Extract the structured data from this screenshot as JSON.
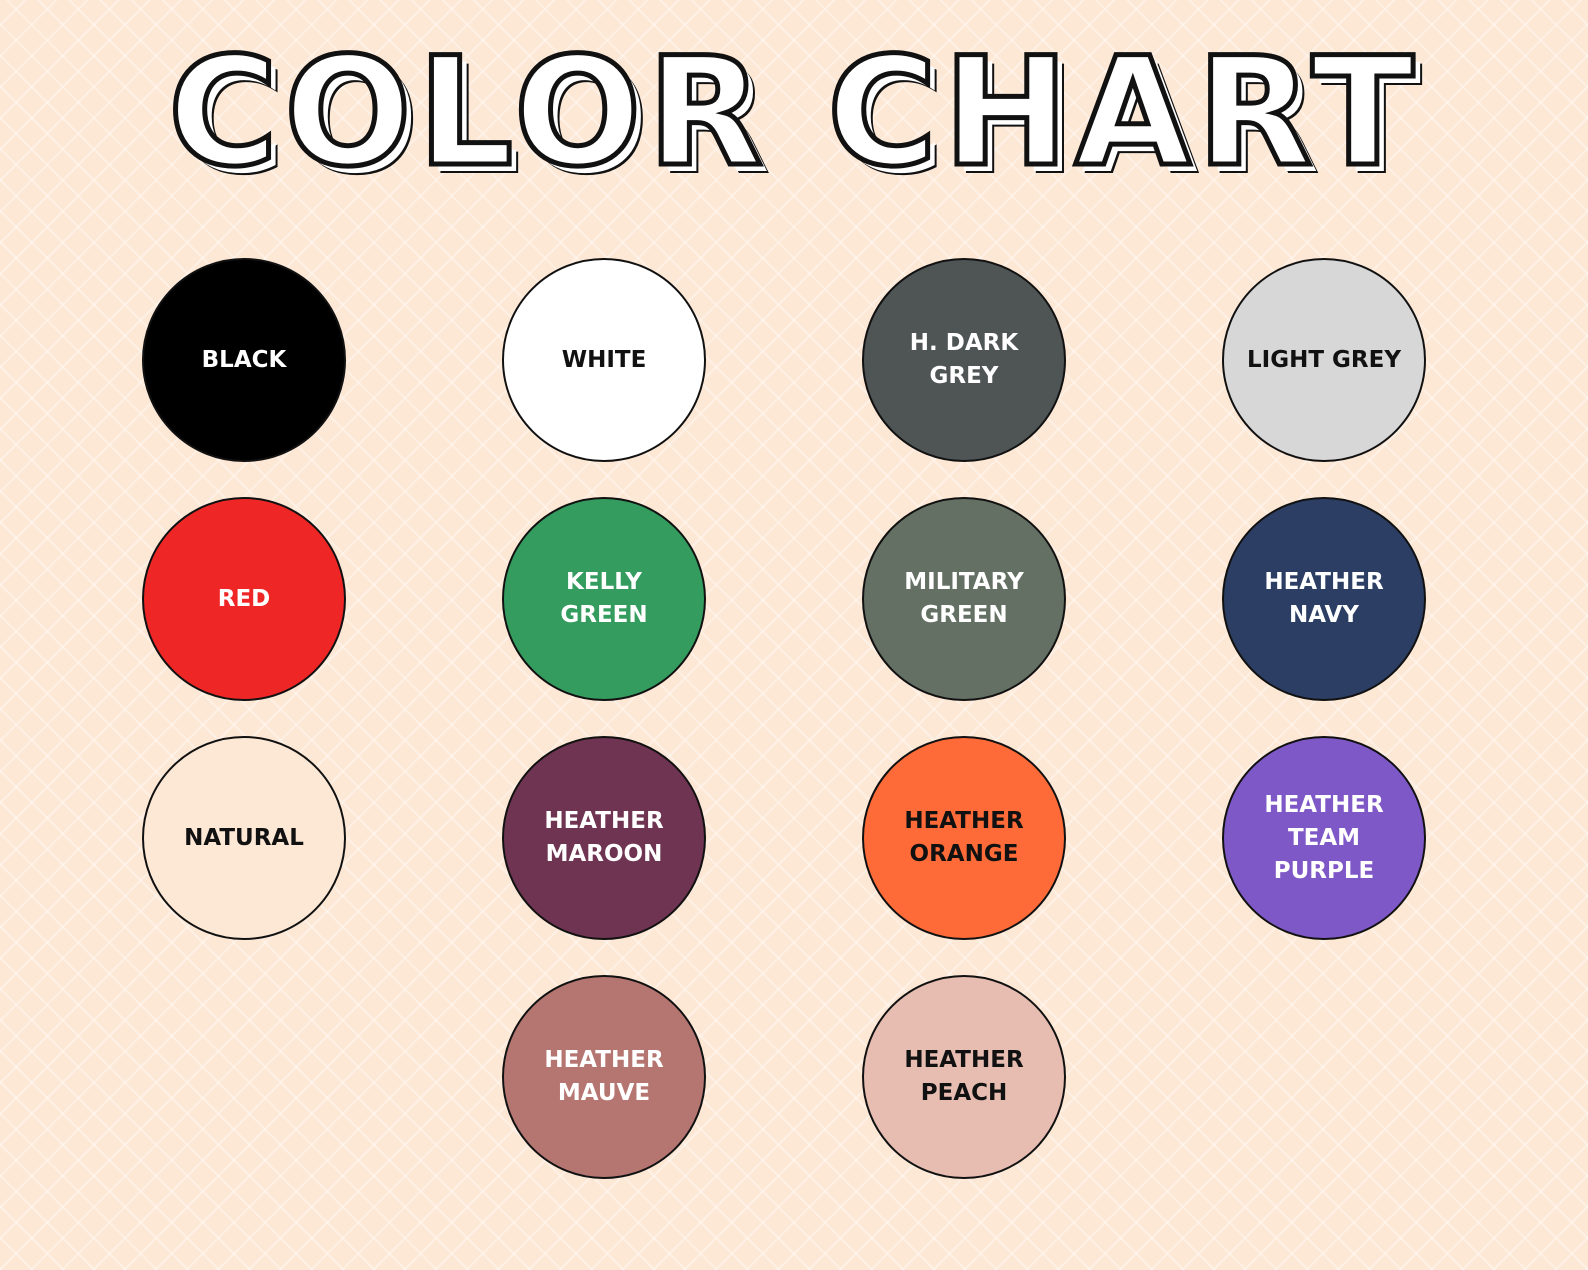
{
  "title": "COLOR CHART",
  "swatches": [
    {
      "label": "BLACK",
      "fill": "#000000",
      "text_color": "#ffffff"
    },
    {
      "label": "WHITE",
      "fill": "#ffffff",
      "text_color": "#111111"
    },
    {
      "label": "H. DARK\nGREY",
      "fill": "#4f5455",
      "text_color": "#ffffff"
    },
    {
      "label": "LIGHT GREY",
      "fill": "#d7d7d7",
      "text_color": "#111111"
    },
    {
      "label": "RED",
      "fill": "#ee2726",
      "text_color": "#ffffff"
    },
    {
      "label": "KELLY GREEN",
      "fill": "#339c5e",
      "text_color": "#ffffff"
    },
    {
      "label": "MILITARY\nGREEN",
      "fill": "#657064",
      "text_color": "#ffffff"
    },
    {
      "label": "HEATHER\nNAVY",
      "fill": "#2c3e63",
      "text_color": "#ffffff"
    },
    {
      "label": "NATURAL",
      "fill": "#fde8d6",
      "text_color": "#111111"
    },
    {
      "label": "HEATHER\nMAROON",
      "fill": "#6e3451",
      "text_color": "#ffffff"
    },
    {
      "label": "HEATHER\nORANGE",
      "fill": "#fe6b38",
      "text_color": "#111111"
    },
    {
      "label": "HEATHER\nTEAM\nPURPLE",
      "fill": "#7f58c7",
      "text_color": "#ffffff"
    },
    {
      "label": "HEATHER\nMAUVE",
      "fill": "#b57672",
      "text_color": "#ffffff"
    },
    {
      "label": "HEATHER\nPEACH",
      "fill": "#e7bdb2",
      "text_color": "#111111"
    }
  ]
}
